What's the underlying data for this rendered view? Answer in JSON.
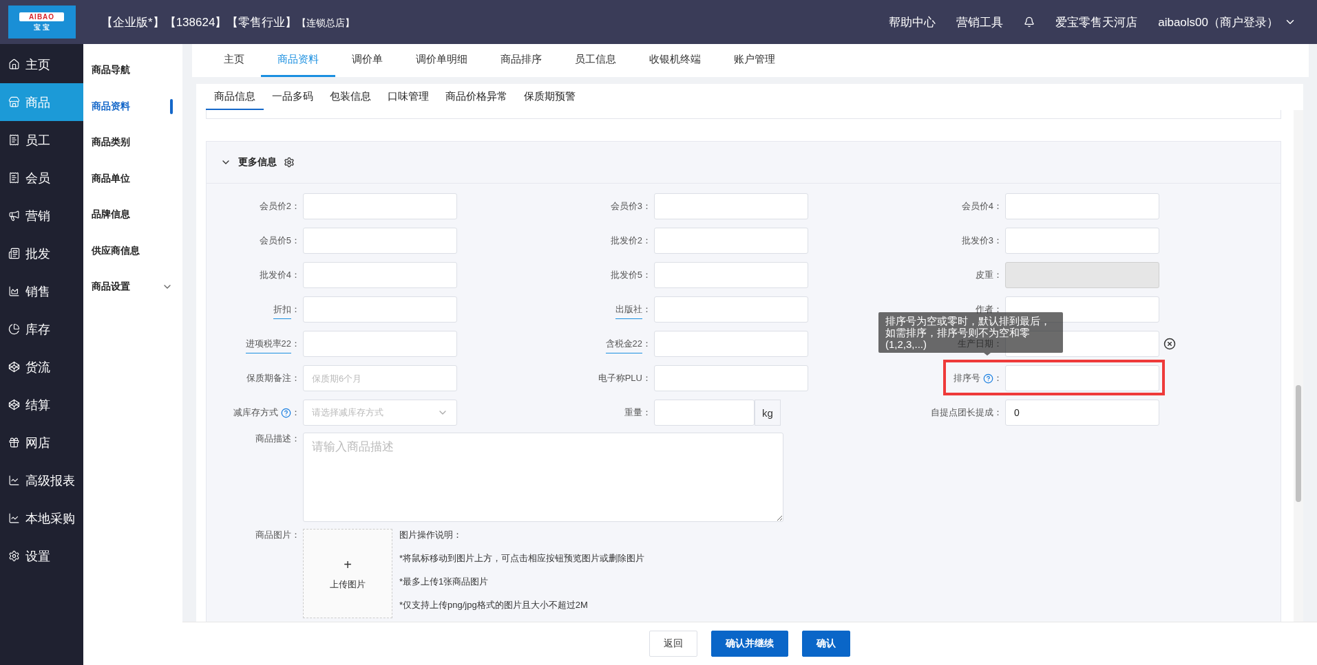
{
  "logo": {
    "brand": "AIBAO",
    "sub": "宝 宝"
  },
  "header": {
    "edition": "【企业版*】",
    "account": "【138624】",
    "industry": "【零售行业】",
    "store_type": "【连锁总店】",
    "links": [
      "帮助中心",
      "营销工具"
    ],
    "store": "爱宝零售天河店",
    "user": "aibaols00（商户登录）"
  },
  "sidebar": {
    "items": [
      {
        "label": "主页",
        "selected": false
      },
      {
        "label": "商品",
        "selected": true
      },
      {
        "label": "员工",
        "selected": false
      },
      {
        "label": "会员",
        "selected": false
      },
      {
        "label": "营销",
        "selected": false
      },
      {
        "label": "批发",
        "selected": false
      },
      {
        "label": "销售",
        "selected": false
      },
      {
        "label": "库存",
        "selected": false
      },
      {
        "label": "货流",
        "selected": false
      },
      {
        "label": "结算",
        "selected": false
      },
      {
        "label": "网店",
        "selected": false
      },
      {
        "label": "高级报表",
        "selected": false
      },
      {
        "label": "本地采购",
        "selected": false
      },
      {
        "label": "设置",
        "selected": false
      }
    ]
  },
  "subnav": {
    "items": [
      {
        "label": "商品导航",
        "selected": false,
        "expandable": false
      },
      {
        "label": "商品资料",
        "selected": true,
        "expandable": false
      },
      {
        "label": "商品类别",
        "selected": false,
        "expandable": false
      },
      {
        "label": "商品单位",
        "selected": false,
        "expandable": false
      },
      {
        "label": "品牌信息",
        "selected": false,
        "expandable": false
      },
      {
        "label": "供应商信息",
        "selected": false,
        "expandable": false
      },
      {
        "label": "商品设置",
        "selected": false,
        "expandable": true
      }
    ]
  },
  "tabs": [
    {
      "label": "主页",
      "selected": false
    },
    {
      "label": "商品资料",
      "selected": true
    },
    {
      "label": "调价单",
      "selected": false
    },
    {
      "label": "调价单明细",
      "selected": false
    },
    {
      "label": "商品排序",
      "selected": false
    },
    {
      "label": "员工信息",
      "selected": false
    },
    {
      "label": "收银机终端",
      "selected": false
    },
    {
      "label": "账户管理",
      "selected": false
    }
  ],
  "sub_tabs": [
    {
      "label": "商品信息",
      "selected": true
    },
    {
      "label": "一品多码",
      "selected": false
    },
    {
      "label": "包装信息",
      "selected": false
    },
    {
      "label": "口味管理",
      "selected": false
    },
    {
      "label": "商品价格异常",
      "selected": false
    },
    {
      "label": "保质期预警",
      "selected": false
    }
  ],
  "section": {
    "title": "更多信息",
    "expanded": true,
    "fields": [
      {
        "label": "会员价2",
        "colon": "：",
        "kind": "text",
        "underlined": false,
        "help": false,
        "disabled": false,
        "clearable": false,
        "highlighted": false
      },
      {
        "label": "会员价3",
        "colon": "：",
        "kind": "text",
        "underlined": false,
        "help": false,
        "disabled": false,
        "clearable": false,
        "highlighted": false
      },
      {
        "label": "会员价4",
        "colon": "：",
        "kind": "text",
        "underlined": false,
        "help": false,
        "disabled": false,
        "clearable": false,
        "highlighted": false
      },
      {
        "label": "会员价5",
        "colon": "：",
        "kind": "text",
        "underlined": false,
        "help": false,
        "disabled": false,
        "clearable": false,
        "highlighted": false
      },
      {
        "label": "批发价2",
        "colon": "：",
        "kind": "text",
        "underlined": false,
        "help": false,
        "disabled": false,
        "clearable": false,
        "highlighted": false
      },
      {
        "label": "批发价3",
        "colon": "：",
        "kind": "text",
        "underlined": false,
        "help": false,
        "disabled": false,
        "clearable": false,
        "highlighted": false
      },
      {
        "label": "批发价4",
        "colon": "：",
        "kind": "text",
        "underlined": false,
        "help": false,
        "disabled": false,
        "clearable": false,
        "highlighted": false
      },
      {
        "label": "批发价5",
        "colon": "：",
        "kind": "text",
        "underlined": false,
        "help": false,
        "disabled": false,
        "clearable": false,
        "highlighted": false
      },
      {
        "label": "皮重",
        "colon": "：",
        "kind": "text",
        "underlined": false,
        "help": false,
        "disabled": true,
        "clearable": false,
        "highlighted": false
      },
      {
        "label": "折扣",
        "colon": "：",
        "kind": "text",
        "underlined": true,
        "help": false,
        "disabled": false,
        "clearable": false,
        "highlighted": false
      },
      {
        "label": "出版社",
        "colon": "：",
        "kind": "text",
        "underlined": true,
        "help": false,
        "disabled": false,
        "clearable": false,
        "highlighted": false
      },
      {
        "label": "作者",
        "colon": "：",
        "kind": "text",
        "underlined": false,
        "help": false,
        "disabled": false,
        "clearable": false,
        "highlighted": false
      },
      {
        "label": "进项税率22",
        "colon": "：",
        "kind": "text",
        "underlined": true,
        "help": false,
        "disabled": false,
        "clearable": false,
        "highlighted": false
      },
      {
        "label": "含税金22",
        "colon": "：",
        "kind": "text",
        "underlined": true,
        "help": false,
        "disabled": false,
        "clearable": false,
        "highlighted": false
      },
      {
        "label": "生产日期",
        "colon": "：",
        "kind": "text",
        "underlined": false,
        "help": false,
        "disabled": false,
        "clearable": true,
        "highlighted": false
      },
      {
        "label": "保质期备注",
        "colon": "：",
        "kind": "text",
        "placeholder": "保质期6个月",
        "underlined": false,
        "help": false,
        "disabled": false,
        "clearable": false,
        "highlighted": false
      },
      {
        "label": "电子称PLU",
        "colon": "：",
        "kind": "text",
        "underlined": false,
        "help": false,
        "disabled": false,
        "clearable": false,
        "highlighted": false
      },
      {
        "label": "排序号",
        "colon": "：",
        "kind": "text",
        "underlined": false,
        "help": true,
        "disabled": false,
        "clearable": false,
        "highlighted": true,
        "tooltip": "排序号为空或零时，默认排到最后，如需排序，排序号则不为空和零(1,2,3,...)"
      },
      {
        "label": "减库存方式",
        "colon": "：",
        "kind": "select",
        "placeholder": "请选择减库存方式",
        "underlined": false,
        "help": true,
        "disabled": false,
        "clearable": false,
        "highlighted": false
      },
      {
        "label": "重量",
        "colon": "：",
        "kind": "unit",
        "unit": "kg",
        "underlined": false,
        "help": false,
        "disabled": false,
        "clearable": false,
        "highlighted": false
      },
      {
        "label": "自提点团长提成",
        "colon": "：",
        "kind": "text",
        "value": "0",
        "underlined": false,
        "help": false,
        "disabled": false,
        "clearable": false,
        "highlighted": false
      }
    ],
    "description": {
      "label": "商品描述",
      "colon": "：",
      "placeholder": "请输入商品描述"
    },
    "image": {
      "label": "商品图片",
      "colon": "：",
      "plus": "+",
      "button": "上传图片",
      "notes": [
        "图片操作说明：",
        "*将鼠标移动到图片上方，可点击相应按钮预览图片或删除图片",
        "*最多上传1张商品图片",
        "*仅支持上传png/jpg格式的图片且大小不超过2M"
      ]
    }
  },
  "footer": {
    "buttons": [
      {
        "label": "返回",
        "kind": "default"
      },
      {
        "label": "确认并继续",
        "kind": "primary"
      },
      {
        "label": "确认",
        "kind": "primary"
      }
    ]
  }
}
